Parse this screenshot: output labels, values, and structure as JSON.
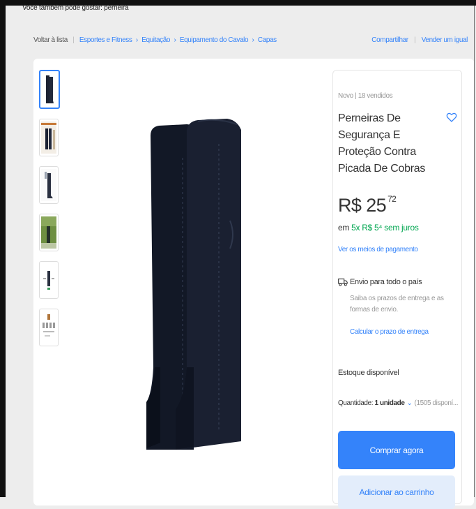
{
  "top_cut_text": "Você também pode gostar: perneira",
  "breadcrumb": {
    "back": "Voltar à lista",
    "items": [
      "Esportes e Fitness",
      "Equitação",
      "Equipamento do Cavalo",
      "Capas"
    ]
  },
  "actions": {
    "share": "Compartilhar",
    "sell": "Vender um igual"
  },
  "thumbnails": [
    {
      "name": "thumbnail-1",
      "selected": true
    },
    {
      "name": "thumbnail-2"
    },
    {
      "name": "thumbnail-3"
    },
    {
      "name": "thumbnail-4"
    },
    {
      "name": "thumbnail-5"
    },
    {
      "name": "thumbnail-6"
    }
  ],
  "product": {
    "condition": "Novo  |  18 vendidos",
    "title": "Perneiras De Segurança E Proteção Contra Picada De Cobras",
    "price_integer": "R$ 25",
    "price_cents": "72",
    "installments_prefix": "em ",
    "installments_highlight": "5x R$ 5⁴ sem juros",
    "payment_link": "Ver os meios de pagamento"
  },
  "shipping": {
    "title": "Envio para todo o país",
    "description": "Saiba os prazos de entrega e as formas de envio.",
    "link": "Calcular o prazo de entrega"
  },
  "stock": {
    "label": "Estoque disponível",
    "quantity_label": "Quantidade: ",
    "quantity_value": "1 unidade",
    "available": "(1505 disponí..."
  },
  "buttons": {
    "buy_now": "Comprar agora",
    "add_to_cart": "Adicionar ao carrinho"
  },
  "colors": {
    "accent": "#3483fa",
    "green": "#00a650",
    "background": "#ededed"
  },
  "icons": [
    "heart-icon",
    "truck-icon",
    "chevron-down-icon"
  ]
}
